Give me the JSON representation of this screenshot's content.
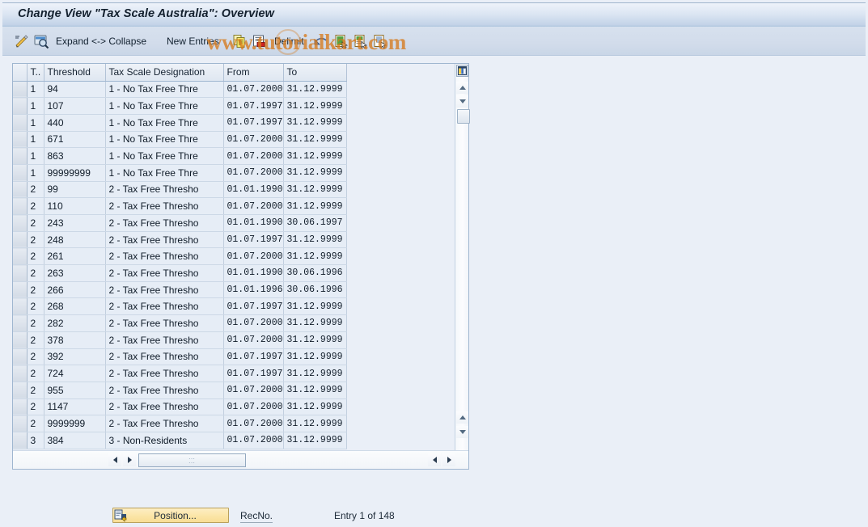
{
  "window": {
    "title": "Change View \"Tax Scale Australia\": Overview"
  },
  "toolbar": {
    "items": [
      {
        "name": "display-change-icon",
        "label": "",
        "icon": "pencil-magnifier-icon"
      },
      {
        "name": "details-icon",
        "label": "",
        "icon": "magnifier-icon"
      },
      {
        "name": "expand-collapse",
        "label": "Expand <-> Collapse"
      },
      {
        "name": "new-entries",
        "label": "New Entries"
      },
      {
        "name": "copy-icon",
        "label": "",
        "icon": "copy-icon"
      },
      {
        "name": "delete-icon",
        "label": "",
        "icon": "delete-row-icon"
      },
      {
        "name": "delimit",
        "label": "Delimit"
      },
      {
        "name": "undo-icon",
        "label": "",
        "icon": "undo-arrow-icon"
      },
      {
        "name": "select-all-icon",
        "label": "",
        "icon": "select-all-icon"
      },
      {
        "name": "deselect-all-icon",
        "label": "",
        "icon": "deselect-all-icon"
      },
      {
        "name": "select-block-icon",
        "label": "",
        "icon": "select-block-icon"
      }
    ],
    "expand_collapse_label": "Expand <-> Collapse",
    "new_entries_label": "New Entries",
    "delimit_label": "Delimit"
  },
  "watermark": {
    "text": "www.tutorialkart.com",
    "color": "#d67a1c"
  },
  "table": {
    "columns": [
      {
        "key": "t",
        "label": "T.."
      },
      {
        "key": "threshold",
        "label": "Threshold"
      },
      {
        "key": "designation",
        "label": "Tax Scale Designation"
      },
      {
        "key": "from",
        "label": "From"
      },
      {
        "key": "to",
        "label": "To"
      }
    ],
    "rows": [
      {
        "t": "1",
        "threshold": "94",
        "designation": "1 - No Tax Free Thre",
        "from": "01.07.2000",
        "to": "31.12.9999"
      },
      {
        "t": "1",
        "threshold": "107",
        "designation": "1 - No Tax Free Thre",
        "from": "01.07.1997",
        "to": "31.12.9999"
      },
      {
        "t": "1",
        "threshold": "440",
        "designation": "1 - No Tax Free Thre",
        "from": "01.07.1997",
        "to": "31.12.9999"
      },
      {
        "t": "1",
        "threshold": "671",
        "designation": "1 - No Tax Free Thre",
        "from": "01.07.2000",
        "to": "31.12.9999"
      },
      {
        "t": "1",
        "threshold": "863",
        "designation": "1 - No Tax Free Thre",
        "from": "01.07.2000",
        "to": "31.12.9999"
      },
      {
        "t": "1",
        "threshold": "99999999",
        "designation": "1 - No Tax Free Thre",
        "from": "01.07.2000",
        "to": "31.12.9999"
      },
      {
        "t": "2",
        "threshold": "99",
        "designation": "2 - Tax Free Thresho",
        "from": "01.01.1990",
        "to": "31.12.9999"
      },
      {
        "t": "2",
        "threshold": "110",
        "designation": "2 - Tax Free Thresho",
        "from": "01.07.2000",
        "to": "31.12.9999"
      },
      {
        "t": "2",
        "threshold": "243",
        "designation": "2 - Tax Free Thresho",
        "from": "01.01.1990",
        "to": "30.06.1997"
      },
      {
        "t": "2",
        "threshold": "248",
        "designation": "2 - Tax Free Thresho",
        "from": "01.07.1997",
        "to": "31.12.9999"
      },
      {
        "t": "2",
        "threshold": "261",
        "designation": "2 - Tax Free Thresho",
        "from": "01.07.2000",
        "to": "31.12.9999"
      },
      {
        "t": "2",
        "threshold": "263",
        "designation": "2 - Tax Free Thresho",
        "from": "01.01.1990",
        "to": "30.06.1996"
      },
      {
        "t": "2",
        "threshold": "266",
        "designation": "2 - Tax Free Thresho",
        "from": "01.01.1996",
        "to": "30.06.1996"
      },
      {
        "t": "2",
        "threshold": "268",
        "designation": "2 - Tax Free Thresho",
        "from": "01.07.1997",
        "to": "31.12.9999"
      },
      {
        "t": "2",
        "threshold": "282",
        "designation": "2 - Tax Free Thresho",
        "from": "01.07.2000",
        "to": "31.12.9999"
      },
      {
        "t": "2",
        "threshold": "378",
        "designation": "2 - Tax Free Thresho",
        "from": "01.07.2000",
        "to": "31.12.9999"
      },
      {
        "t": "2",
        "threshold": "392",
        "designation": "2 - Tax Free Thresho",
        "from": "01.07.1997",
        "to": "31.12.9999"
      },
      {
        "t": "2",
        "threshold": "724",
        "designation": "2 - Tax Free Thresho",
        "from": "01.07.1997",
        "to": "31.12.9999"
      },
      {
        "t": "2",
        "threshold": "955",
        "designation": "2 - Tax Free Thresho",
        "from": "01.07.2000",
        "to": "31.12.9999"
      },
      {
        "t": "2",
        "threshold": "1147",
        "designation": "2 - Tax Free Thresho",
        "from": "01.07.2000",
        "to": "31.12.9999"
      },
      {
        "t": "2",
        "threshold": "9999999",
        "designation": "2 - Tax Free Thresho",
        "from": "01.07.2000",
        "to": "31.12.9999"
      },
      {
        "t": "3",
        "threshold": "384",
        "designation": "3 - Non-Residents",
        "from": "01.07.2000",
        "to": "31.12.9999"
      }
    ]
  },
  "footer": {
    "position_label": "Position...",
    "recno_label": "RecNo.",
    "entry_status": "Entry 1 of 148"
  }
}
